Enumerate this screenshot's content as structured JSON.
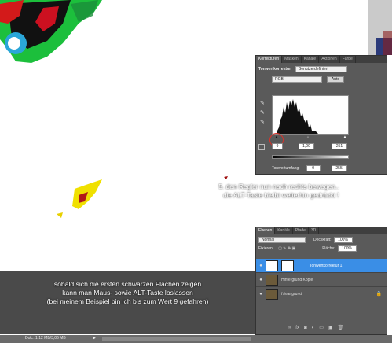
{
  "canvas_overlay": {
    "instruction_right_line1": "5. den Regler nun nach rechts bewegen..",
    "instruction_right_line2": "die ALT-Taste bleibt weiterhin gedrückt !",
    "instruction_bottom_line1": "sobald sich die ersten schwarzen Flächen zeigen",
    "instruction_bottom_line2": "kann man Maus- sowie ALT-Taste loslassen",
    "instruction_bottom_line3": "(bei meinem Beispiel bin ich bis zum Wert 9 gefahren)"
  },
  "adjustments_panel": {
    "tabs": [
      "Korrekturen",
      "Masken",
      "Kanäle",
      "Aktionen",
      "Farbe"
    ],
    "title": "Tonwertkorrektur",
    "preset_value": "Benutzerdefiniert",
    "channel_value": "RGB",
    "auto_label": "Auto",
    "input_black": "9",
    "input_gamma": "1,00",
    "input_white": "251",
    "output_label": "Tonwertumfang:",
    "output_black": "0",
    "output_white": "255"
  },
  "layers_panel": {
    "tabs": [
      "Ebenen",
      "Kanäle",
      "Pfade",
      "3D"
    ],
    "blend_mode": "Normal",
    "opacity_label": "Deckkraft:",
    "opacity_value": "100%",
    "lock_label": "Fixieren:",
    "fill_label": "Fläche:",
    "fill_value": "100%",
    "layers": [
      {
        "name": "Tonwertkorrektur 1"
      },
      {
        "name": "Hintergrund Kopie"
      },
      {
        "name": "Hintergrund"
      }
    ]
  },
  "status_bar": {
    "doc_info": "Dok.: 1,12 MB/3,06 MB"
  },
  "colors": {
    "panel_bg": "#5a5a5a",
    "selected_layer": "#3a8ee6",
    "highlight_circle": "#d9322a"
  }
}
